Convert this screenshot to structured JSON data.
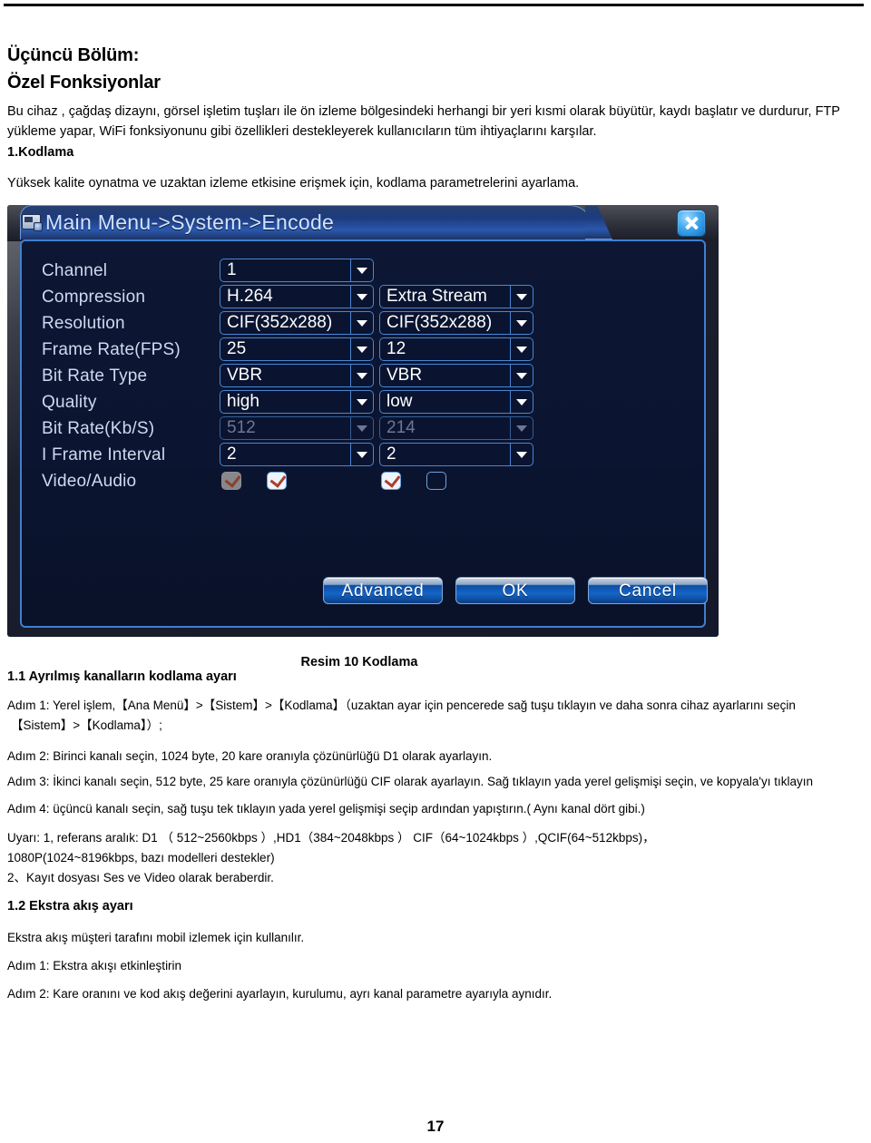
{
  "document": {
    "chapter_title_line1": "Üçüncü Bölüm:",
    "chapter_title_line2": "Özel Fonksiyonlar",
    "intro_line1": "Bu cihaz , çağdaş dizaynı, görsel işletim tuşları ile   ön izleme bölgesindeki herhangi bir yeri kısmi olarak büyütür, kaydı başlatır ve durdurur, FTP",
    "intro_line2": "yükleme yapar, WiFi fonksiyonunu gibi özellikleri destekleyerek kullanıcıların tüm ihtiyaçlarını karşılar.",
    "section_1_heading": "1.Kodlama",
    "section_1_desc": "Yüksek kalite oynatma ve uzaktan izleme etkisine erişmek için, kodlama parametrelerini ayarlama.",
    "figure_caption": "Resim 10 Kodlama",
    "section_1_1_heading": "1.1 Ayrılmış kanalların kodlama ayarı",
    "adim1": "Adım 1: Yerel işlem,【Ana Menü】>【Sistem】>【Kodlama】（uzaktan ayar için pencerede sağ tuşu tıklayın ve daha sonra cihaz ayarlarını seçin",
    "adim1b": "【Sistem】>【Kodlama】）;",
    "adim2": "Adım 2: Birinci kanalı seçin, 1024 byte, 20 kare oranıyla çözünürlüğü D1 olarak ayarlayın.",
    "adim3": "Adım 3: İkinci kanalı seçin, 512 byte, 25 kare oranıyla çözünürlüğü CIF olarak ayarlayın. Sağ tıklayın yada yerel gelişmişi seçin, ve kopyala'yı tıklayın",
    "adim4": "Adım 4: üçüncü kanalı seçin, sağ tuşu tek tıklayın yada yerel gelişmişi seçip ardından yapıştırın.( Aynı kanal dört gibi.)",
    "uyari_line1": "Uyarı: 1, referans aralık: D1 （ 512~2560kbps ）,HD1（384~2048kbps ） CIF（64~1024kbps ）,QCIF(64~512kbps)，",
    "uyari_line2": "1080P(1024~8196kbps, bazı modelleri destekler)",
    "kayit": "2、Kayıt dosyası Ses ve Video olarak beraberdir.",
    "section_1_2_heading": "1.2 Ekstra akış ayarı",
    "ekstra_desc": "Ekstra akış müşteri tarafını mobil izlemek için kullanılır.",
    "ekstra_adim1": "Adım 1: Ekstra akışı etkinleştirin",
    "ekstra_adim2": "Adım 2: Kare oranını ve kod akış değerini ayarlayın, kurulumu, ayrı kanal parametre ayarıyla aynıdır.",
    "page_number": "17"
  },
  "dialog": {
    "title": "Main Menu->System->Encode",
    "title_icon": "monitor-settings-icon",
    "close_icon": "close-icon",
    "rows": [
      {
        "label": "Channel",
        "main": "1",
        "extra": null,
        "main_disabled": false,
        "extra_disabled": false
      },
      {
        "label": "Compression",
        "main": "H.264",
        "extra": "Extra Stream",
        "main_disabled": false,
        "extra_disabled": false
      },
      {
        "label": "Resolution",
        "main": "CIF(352x288)",
        "extra": "CIF(352x288)",
        "main_disabled": false,
        "extra_disabled": false
      },
      {
        "label": "Frame Rate(FPS)",
        "main": "25",
        "extra": "12",
        "main_disabled": false,
        "extra_disabled": false
      },
      {
        "label": "Bit Rate Type",
        "main": "VBR",
        "extra": "VBR",
        "main_disabled": false,
        "extra_disabled": false
      },
      {
        "label": "Quality",
        "main": "high",
        "extra": "low",
        "main_disabled": false,
        "extra_disabled": false
      },
      {
        "label": "Bit Rate(Kb/S)",
        "main": "512",
        "extra": "214",
        "main_disabled": true,
        "extra_disabled": true
      },
      {
        "label": "I Frame Interval",
        "main": "2",
        "extra": "2",
        "main_disabled": false,
        "extra_disabled": false
      }
    ],
    "video_audio": {
      "label": "Video/Audio",
      "checkboxes": [
        {
          "name": "main-video-checkbox",
          "state": "checked-disabled"
        },
        {
          "name": "main-audio-checkbox",
          "state": "checked"
        },
        {
          "name": "extra-video-checkbox",
          "state": "checked"
        },
        {
          "name": "extra-audio-checkbox",
          "state": "unchecked"
        }
      ]
    },
    "buttons": [
      {
        "name": "advanced-button",
        "label": "Advanced"
      },
      {
        "name": "ok-button",
        "label": "OK"
      },
      {
        "name": "cancel-button",
        "label": "Cancel"
      }
    ],
    "colors": {
      "panel_bg": "#0b1430",
      "panel_border": "#3f7fd0",
      "label_text": "#cfd9ef",
      "value_text": "#ffffff",
      "disabled_text": "#6b7894",
      "title_text": "#d2e3ff",
      "accent": "#1565c6",
      "tick": "#a8402c"
    }
  }
}
